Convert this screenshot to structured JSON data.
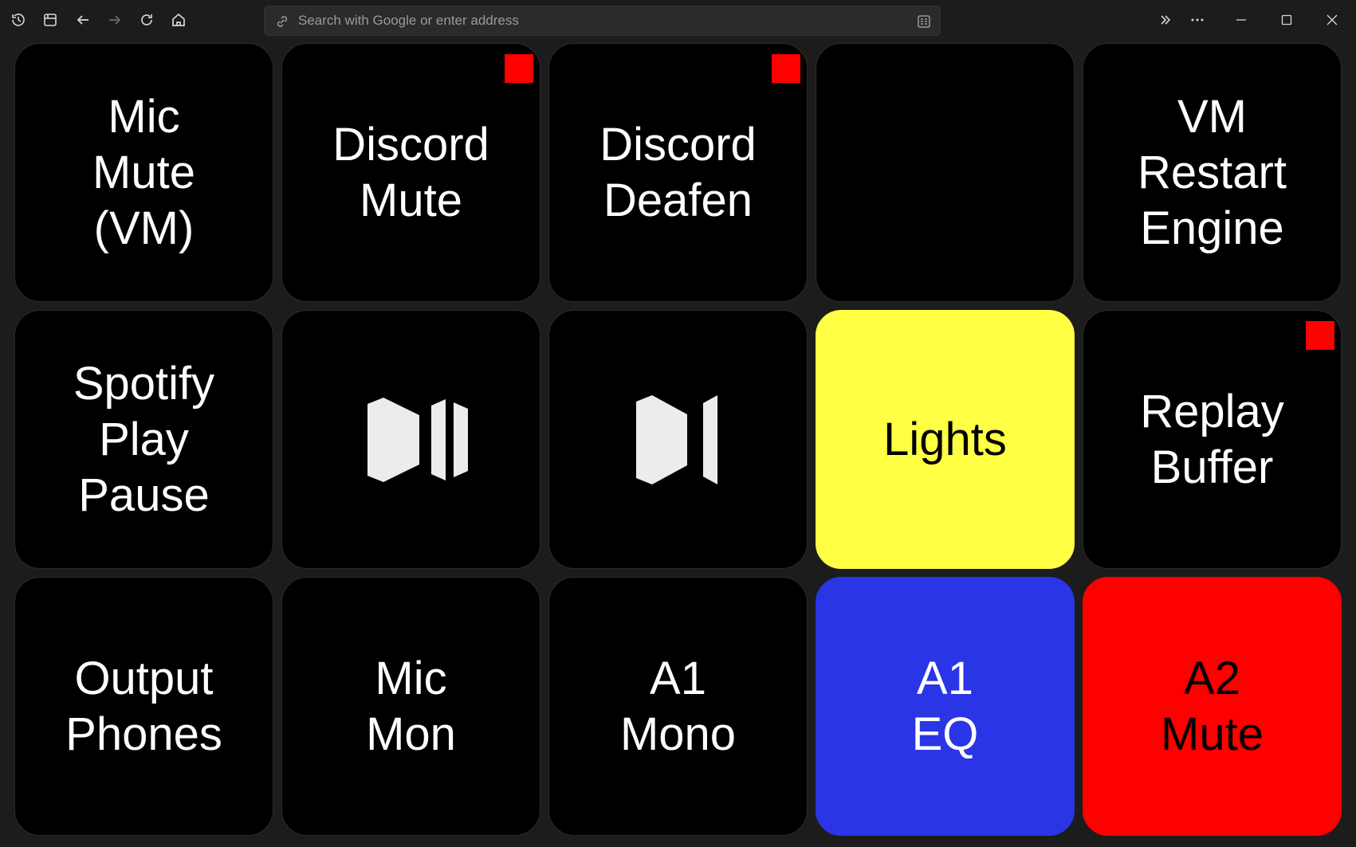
{
  "browser": {
    "address_placeholder": "Search with Google or enter address",
    "toolbar_icons": [
      "history-icon",
      "save-icon",
      "back-icon",
      "forward-icon",
      "reload-icon",
      "home-icon"
    ],
    "window_icons": [
      "overflow-icon",
      "menu-icon",
      "minimize-icon",
      "maximize-icon",
      "close-icon"
    ]
  },
  "deck": {
    "keys": [
      {
        "label": "Mic\nMute\n(VM)",
        "style": "black",
        "indicator": false
      },
      {
        "label": "Discord\nMute",
        "style": "black",
        "indicator": true
      },
      {
        "label": "Discord\nDeafen",
        "style": "black",
        "indicator": true
      },
      {
        "label": "",
        "style": "black",
        "indicator": false
      },
      {
        "label": "VM\nRestart\nEngine",
        "style": "black",
        "indicator": false
      },
      {
        "label": "Spotify\nPlay\nPause",
        "style": "black",
        "indicator": false
      },
      {
        "label": "",
        "icon": "play-pause-icon",
        "style": "black",
        "indicator": false
      },
      {
        "label": "",
        "icon": "next-track-icon",
        "style": "black",
        "indicator": false
      },
      {
        "label": "Lights",
        "style": "yellow",
        "indicator": false
      },
      {
        "label": "Replay\nBuffer",
        "style": "black",
        "indicator": true
      },
      {
        "label": "Output\nPhones",
        "style": "black",
        "indicator": false
      },
      {
        "label": "Mic\nMon",
        "style": "black",
        "indicator": false
      },
      {
        "label": "A1\nMono",
        "style": "black",
        "indicator": false
      },
      {
        "label": "A1\nEQ",
        "style": "blue",
        "indicator": false
      },
      {
        "label": "A2\nMute",
        "style": "red",
        "indicator": false
      }
    ],
    "colors": {
      "key_bg": "#000000",
      "yellow": "#ffff44",
      "blue": "#2a35e6",
      "red": "#ff0000",
      "indicator": "#ff0000"
    }
  }
}
